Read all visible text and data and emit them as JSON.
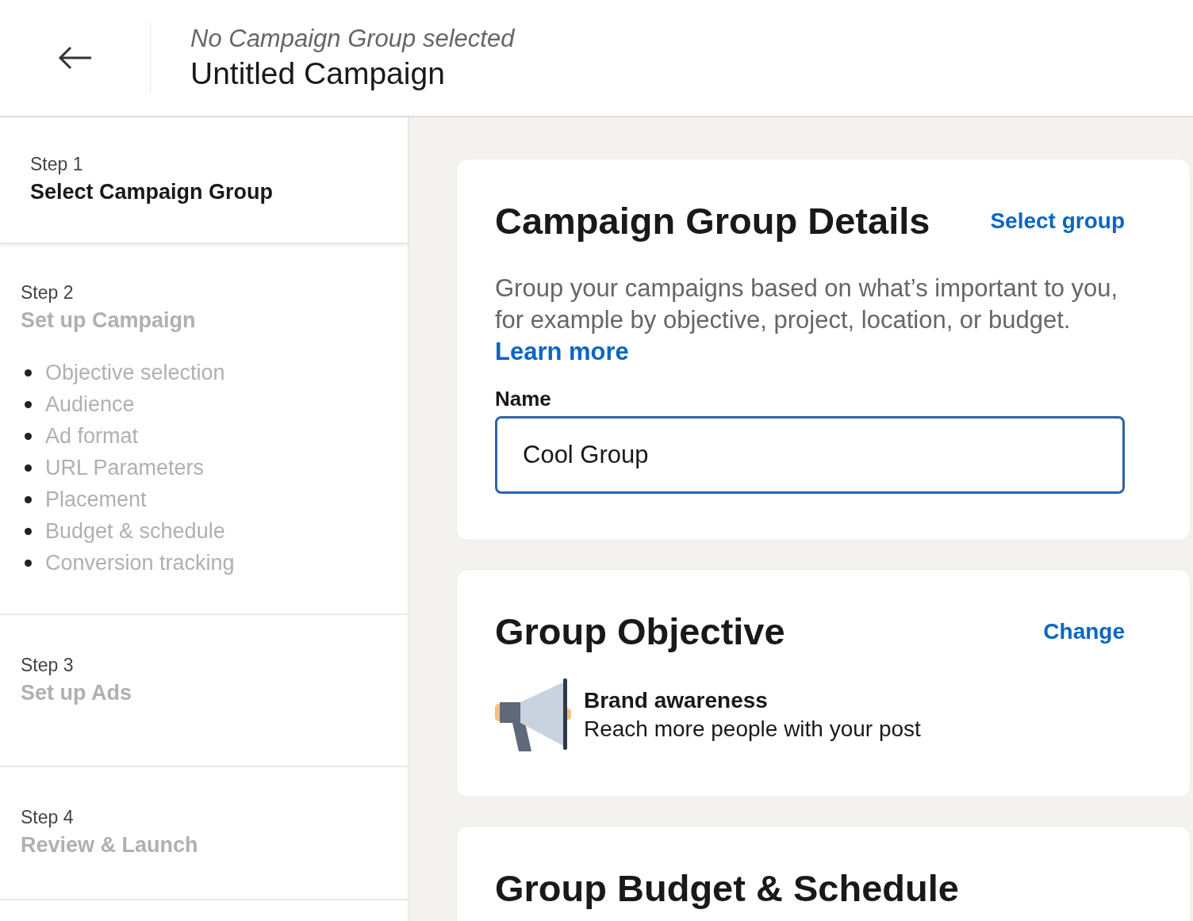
{
  "header": {
    "subtitle": "No Campaign Group selected",
    "title": "Untitled Campaign"
  },
  "steps": [
    {
      "step": "Step 1",
      "title": "Select Campaign Group",
      "selected": true
    },
    {
      "step": "Step 2",
      "title": "Set up Campaign",
      "selected": false,
      "items": [
        "Objective selection",
        "Audience",
        "Ad format",
        "URL Parameters",
        "Placement",
        "Budget & schedule",
        "Conversion tracking"
      ]
    },
    {
      "step": "Step 3",
      "title": "Set up Ads",
      "selected": false
    },
    {
      "step": "Step 4",
      "title": "Review & Launch",
      "selected": false
    }
  ],
  "details_card": {
    "title": "Campaign Group Details",
    "action": "Select group",
    "description": "Group your campaigns based on what’s important to you, for example by objective, project, location, or budget.",
    "link": "Learn more",
    "field_label": "Name",
    "field_value": "Cool Group"
  },
  "objective_card": {
    "title": "Group Objective",
    "action": "Change",
    "objective": "Brand awareness",
    "objective_description": "Reach more people with your post"
  },
  "budget_card": {
    "title": "Group Budget & Schedule"
  }
}
